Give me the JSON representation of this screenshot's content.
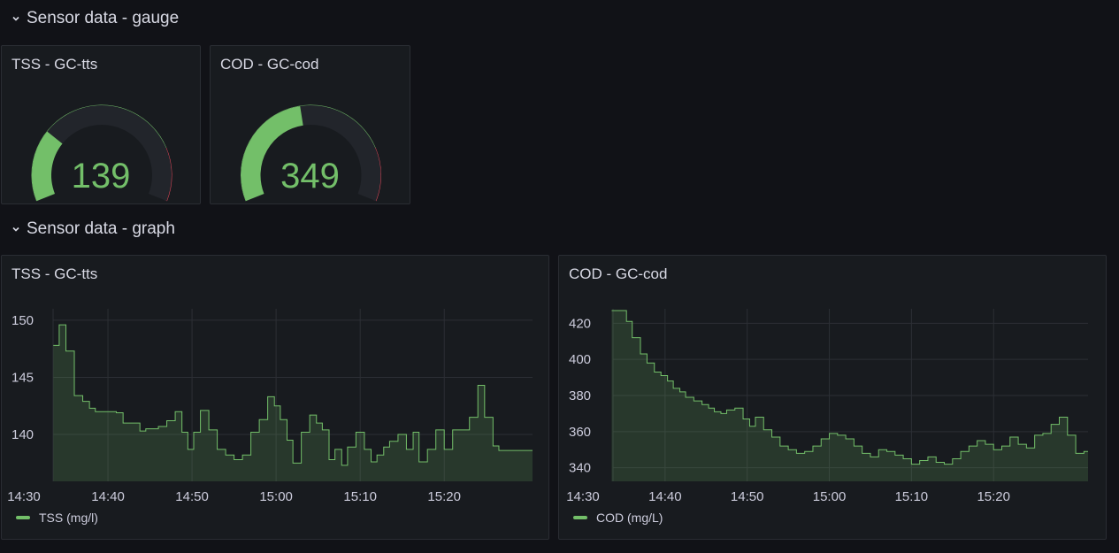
{
  "rows": {
    "gauge_row": {
      "title": "Sensor data - gauge"
    },
    "graph_row": {
      "title": "Sensor data - graph"
    }
  },
  "gauges": [
    {
      "title": "TSS - GC-tts",
      "value": "139",
      "fraction": 0.27,
      "threshold_fraction": 0.8
    },
    {
      "title": "COD - GC-cod",
      "value": "349",
      "fraction": 0.46,
      "threshold_fraction": 0.8
    }
  ],
  "colors": {
    "green": "#73bf69",
    "red": "#f2495c",
    "track": "#22252b"
  },
  "chart_data": [
    {
      "type": "area",
      "title": "TSS - GC-tts",
      "legend": "TSS (mg/l)",
      "legend_placement": "bottom-left",
      "grid": true,
      "x_tick_labels": [
        "14:30",
        "14:40",
        "14:50",
        "15:00",
        "15:10",
        "15:20"
      ],
      "y_tick_labels": [
        "150",
        "145",
        "140"
      ],
      "x_ticks_min": [
        0,
        10,
        20,
        30,
        40,
        50
      ],
      "y_ticks": [
        150,
        145,
        140
      ],
      "xlim": [
        0,
        60.5
      ],
      "ylim": [
        135.9,
        151
      ],
      "x": [
        3.5,
        4.2,
        5.0,
        6.0,
        7.0,
        7.8,
        8.5,
        9.2,
        10.0,
        11.0,
        11.8,
        12.5,
        13.8,
        14.5,
        15.3,
        16.0,
        17.0,
        18.0,
        18.8,
        19.5,
        20.2,
        21.0,
        22.0,
        23.0,
        24.0,
        25.0,
        26.0,
        27.0,
        28.0,
        29.0,
        29.8,
        30.5,
        31.3,
        32.0,
        33.0,
        34.0,
        34.8,
        35.5,
        36.3,
        37.0,
        37.8,
        38.5,
        39.5,
        40.5,
        41.3,
        42.0,
        42.8,
        43.5,
        44.5,
        45.5,
        46.3,
        47.0,
        48.0,
        49.0,
        50.0,
        51.0,
        52.0,
        53.0,
        54.0,
        54.8,
        55.8,
        56.5,
        57.3,
        58.0,
        59.0,
        60.0
      ],
      "y": [
        147.8,
        149.6,
        147.3,
        143.4,
        142.9,
        142.3,
        142.0,
        142.0,
        142.0,
        141.9,
        141.0,
        141.0,
        140.3,
        140.5,
        140.5,
        140.7,
        141.2,
        142.0,
        140.2,
        138.7,
        140.2,
        142.1,
        140.4,
        138.7,
        138.2,
        137.8,
        138.2,
        140.2,
        141.3,
        143.3,
        142.5,
        141.3,
        139.5,
        137.5,
        140.2,
        141.7,
        141.0,
        140.4,
        137.8,
        138.7,
        137.3,
        138.9,
        140.2,
        138.7,
        137.6,
        138.2,
        138.9,
        139.4,
        140.0,
        138.7,
        140.2,
        137.6,
        138.7,
        140.4,
        138.7,
        140.4,
        140.4,
        141.5,
        144.3,
        141.5,
        139.0,
        138.6,
        138.6,
        138.6,
        138.6,
        138.6
      ]
    },
    {
      "type": "area",
      "title": "COD - GC-cod",
      "legend": "COD (mg/L)",
      "legend_placement": "bottom-left",
      "grid": true,
      "x_tick_labels": [
        "14:30",
        "14:40",
        "14:50",
        "15:00",
        "15:10",
        "15:20"
      ],
      "y_tick_labels": [
        "420",
        "400",
        "380",
        "360",
        "340"
      ],
      "x_ticks_min": [
        0,
        10,
        20,
        30,
        40,
        50
      ],
      "y_ticks": [
        420,
        400,
        380,
        360,
        340
      ],
      "xlim": [
        0,
        61.5
      ],
      "ylim": [
        332.5,
        428
      ],
      "x": [
        3.5,
        4.5,
        5.3,
        6.0,
        7.0,
        7.8,
        8.7,
        9.5,
        10.3,
        11.0,
        11.8,
        12.5,
        13.5,
        14.5,
        15.3,
        16.0,
        16.8,
        17.5,
        18.5,
        19.5,
        20.3,
        21.0,
        22.0,
        23.0,
        24.0,
        25.0,
        26.0,
        27.0,
        28.0,
        29.0,
        30.0,
        31.0,
        32.0,
        33.0,
        34.0,
        35.0,
        36.0,
        37.0,
        38.0,
        39.0,
        40.0,
        41.0,
        42.0,
        43.0,
        44.0,
        45.0,
        46.0,
        47.0,
        48.0,
        49.0,
        50.0,
        51.0,
        52.0,
        53.0,
        54.0,
        55.0,
        56.0,
        57.0,
        58.0,
        59.0,
        60.0,
        61.0
      ],
      "y": [
        427,
        427,
        421,
        412,
        403,
        398,
        393,
        391,
        388,
        384,
        382,
        379,
        377,
        375,
        373,
        371,
        370,
        372,
        373,
        367,
        363,
        368,
        361,
        357,
        352,
        350,
        348,
        349,
        352,
        356,
        359,
        358,
        356,
        352,
        348,
        346,
        350,
        349,
        347,
        345,
        342,
        344,
        346,
        343,
        342,
        345,
        349,
        352,
        355,
        353,
        350,
        352,
        357,
        353,
        351,
        358,
        359,
        364,
        368,
        358,
        348,
        349
      ]
    }
  ]
}
